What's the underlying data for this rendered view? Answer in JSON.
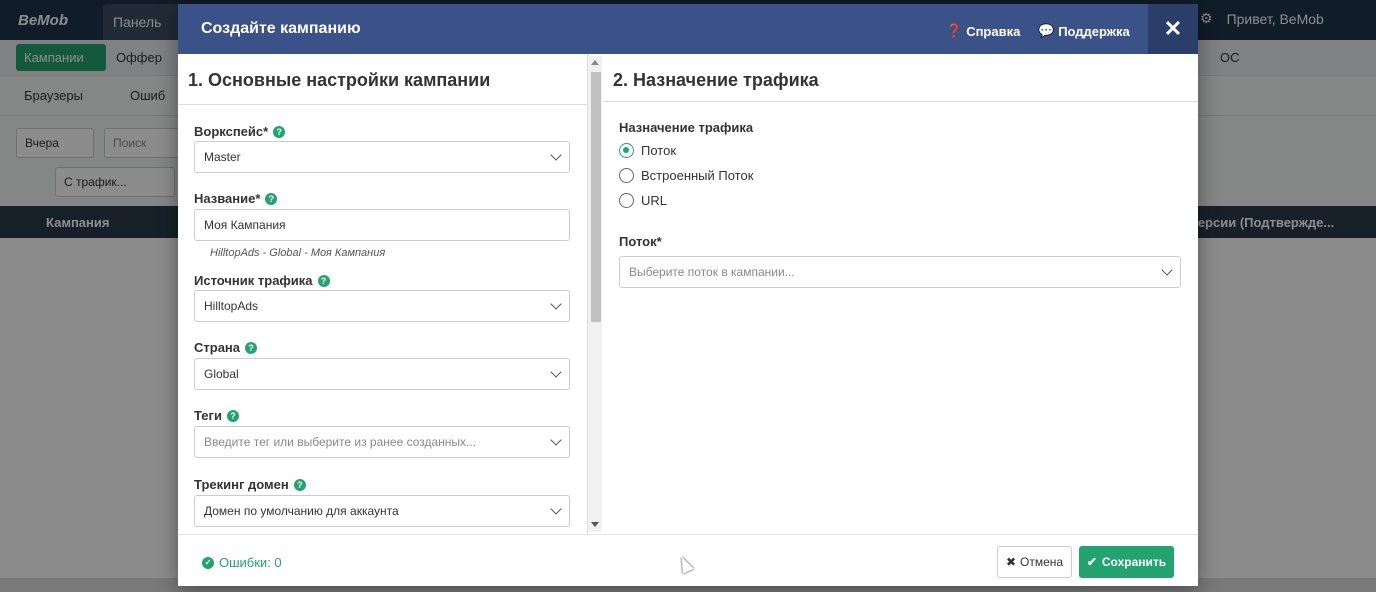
{
  "background": {
    "logo": "BeMob",
    "tab_label": "Панель",
    "greeting": "Привет, BeMob",
    "campaigns_label": "Кампании",
    "offers_label": "Оффер",
    "os_label": "ОС",
    "browsers_label": "Браузеры",
    "errors_label": "Ошиб",
    "yesterday_label": "Вчера",
    "search_placeholder": "Поиск",
    "traffic_label": "С трафик...",
    "col_campaign": "Кампания",
    "col_conversions": "версии (Подтвержде..."
  },
  "modal": {
    "title": "Создайте кампанию",
    "help_label": "Справка",
    "support_label": "Поддержка",
    "left": {
      "section_title": "1. Основные настройки кампании",
      "workspace": {
        "label": "Воркспейс*",
        "value": "Master"
      },
      "name": {
        "label": "Название*",
        "value": "Моя Кампания",
        "hint": "HilltopAds - Global - Моя Кампания"
      },
      "traffic_source": {
        "label": "Источник трафика",
        "value": "HilltopAds"
      },
      "country": {
        "label": "Страна",
        "value": "Global"
      },
      "tags": {
        "label": "Теги",
        "placeholder": "Введите тег или выберите из ранее созданных..."
      },
      "tracking_domain": {
        "label": "Трекинг домен",
        "value": "Домен по умолчанию для аккаунта"
      }
    },
    "right": {
      "section_title": "2. Назначение трафика",
      "destination_label": "Назначение трафика",
      "options": [
        "Поток",
        "Встроенный Поток",
        "URL"
      ],
      "selected_option": "Поток",
      "flow": {
        "label": "Поток*",
        "placeholder": "Выберите поток в кампании..."
      }
    },
    "footer": {
      "errors": "Ошибки: 0",
      "cancel_label": "Отмена",
      "save_label": "Сохранить"
    }
  },
  "colors": {
    "accent": "#23a36f",
    "header": "#3a5287"
  }
}
